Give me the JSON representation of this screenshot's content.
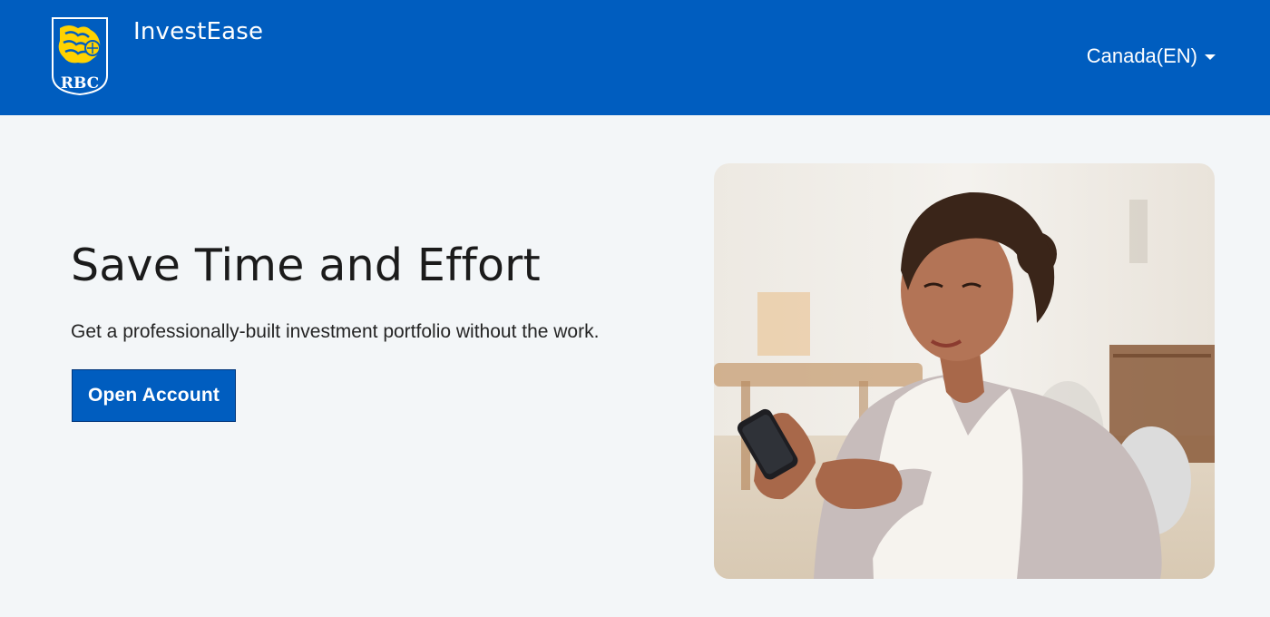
{
  "header": {
    "logo_text": "RBC",
    "brand": "InvestEase",
    "locale": "Canada(EN)"
  },
  "hero": {
    "title": "Save Time and Effort",
    "subtitle": "Get a professionally-built investment portfolio without the work.",
    "cta_label": "Open Account"
  },
  "colors": {
    "brand_blue": "#005dbf",
    "logo_gold": "#ffd200",
    "page_background": "#f3f6f8",
    "title_text": "#1b1b1b"
  },
  "icons": {
    "logo": "rbc-lion-shield-icon",
    "locale_dropdown": "caret-down-icon"
  },
  "photo": {
    "subject": "woman-smiling-at-phone"
  }
}
